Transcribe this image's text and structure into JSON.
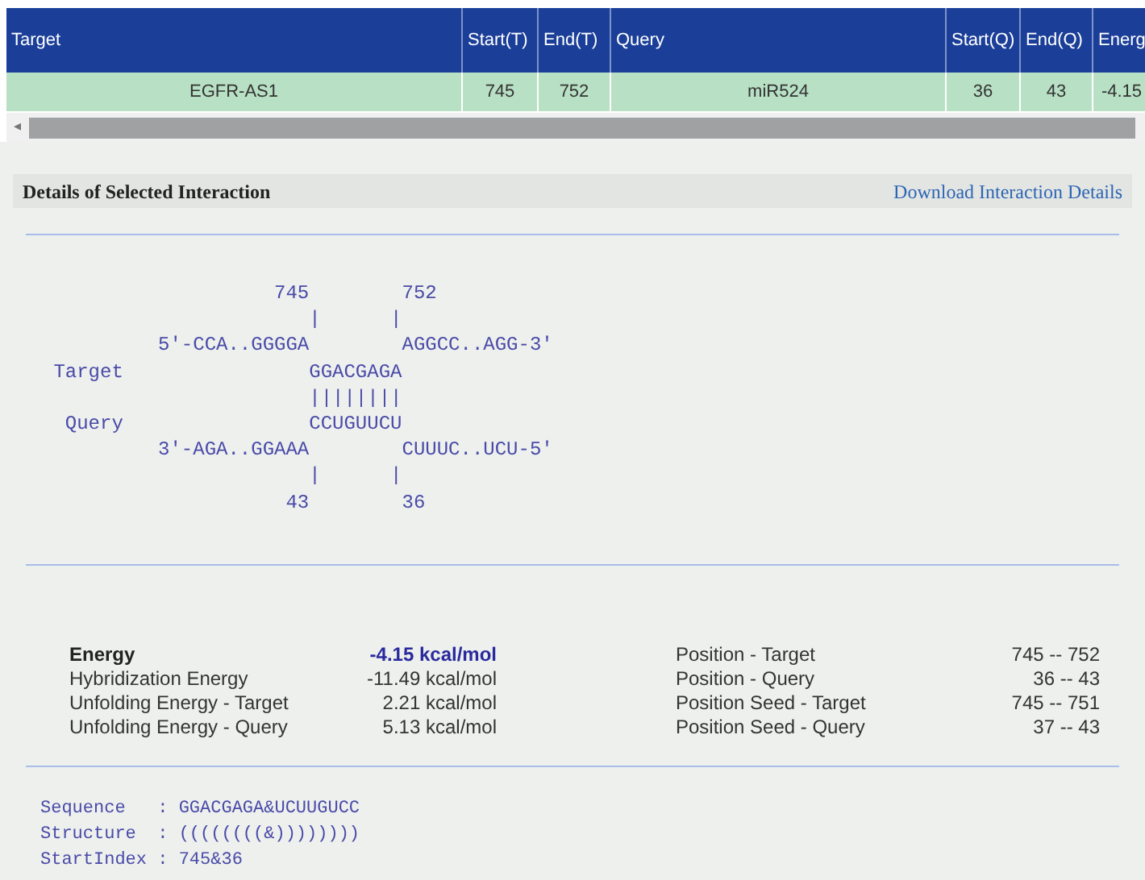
{
  "table": {
    "columns": [
      {
        "label": "Target"
      },
      {
        "label": "Start(T)"
      },
      {
        "label": "End(T)"
      },
      {
        "label": "Query"
      },
      {
        "label": "Start(Q)"
      },
      {
        "label": "End(Q)"
      },
      {
        "label": "Energ"
      }
    ],
    "rows": [
      {
        "selected": true,
        "cells": [
          "EGFR-AS1",
          "745",
          "752",
          "miR524",
          "36",
          "43",
          "-4.15"
        ]
      }
    ]
  },
  "scroll_arrow": "◂",
  "details": {
    "title": "Details of Selected Interaction",
    "download_link": "Download Interaction Details"
  },
  "alignment": [
    "                    745        752",
    "                       |      |",
    "          5'-CCA..GGGGA        AGGCC..AGG-3'",
    " Target                GGACGAGA",
    "                       ||||||||",
    "  Query                CCUGUUCU",
    "          3'-AGA..GGAAA        CUUUC..UCU-5'",
    "                       |      |",
    "                     43        36"
  ],
  "energy": [
    {
      "label": "Energy",
      "value": "-4.15 kcal/mol",
      "emphasis": true
    },
    {
      "label": "Hybridization Energy",
      "value": "-11.49 kcal/mol",
      "emphasis": false
    },
    {
      "label": "Unfolding Energy - Target",
      "value": "2.21 kcal/mol",
      "emphasis": false
    },
    {
      "label": "Unfolding Energy - Query",
      "value": "5.13 kcal/mol",
      "emphasis": false
    }
  ],
  "positions": [
    {
      "label": "Position - Target",
      "value": "745 -- 752"
    },
    {
      "label": "Position - Query",
      "value": "36 -- 43"
    },
    {
      "label": "Position Seed - Target",
      "value": "745 -- 751"
    },
    {
      "label": "Position Seed - Query",
      "value": "37 -- 43"
    }
  ],
  "structure": [
    "Sequence   : GGACGAGA&UCUUGUCC",
    "Structure  : ((((((((&))))))))",
    "StartIndex : 745&36"
  ]
}
